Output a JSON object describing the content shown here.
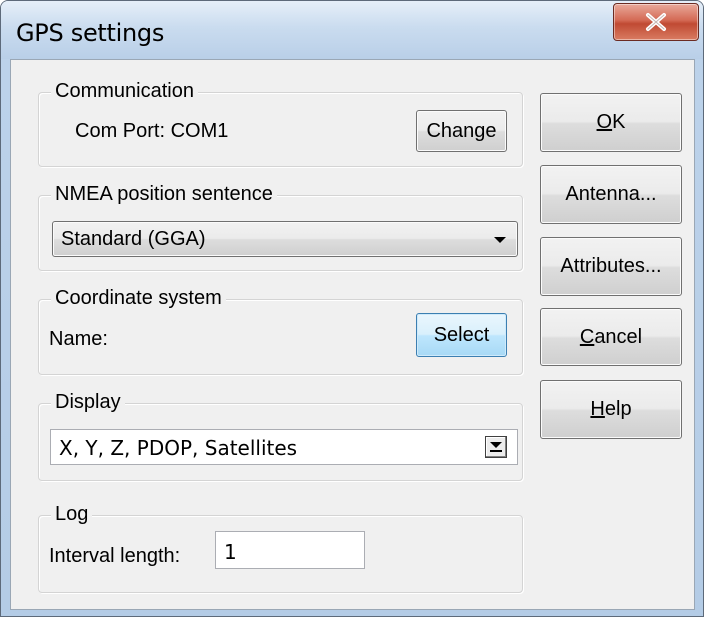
{
  "window": {
    "title": "GPS settings"
  },
  "communication": {
    "group_label": "Communication",
    "com_port_text": "Com Port: COM1",
    "change_label": "Change"
  },
  "nmea": {
    "group_label": "NMEA position sentence",
    "selected": "Standard (GGA)"
  },
  "coordinate_system": {
    "group_label": "Coordinate system",
    "name_label": "Name:",
    "select_label": "Select"
  },
  "display": {
    "group_label": "Display",
    "selected": "X, Y, Z, PDOP, Satellites"
  },
  "log": {
    "group_label": "Log",
    "interval_label": "Interval length:",
    "interval_value": "1"
  },
  "buttons": {
    "ok_mnemonic": "O",
    "ok_rest": "K",
    "antenna": "Antenna...",
    "attributes": "Attributes...",
    "cancel_mnemonic": "C",
    "cancel_rest": "ancel",
    "help_mnemonic": "H",
    "help_rest": "elp"
  },
  "icons": {
    "close": "close-icon",
    "dropdown": "chevron-down-icon"
  },
  "colors": {
    "close_button": "#c04a33",
    "hot_button": "#bee6fd"
  }
}
